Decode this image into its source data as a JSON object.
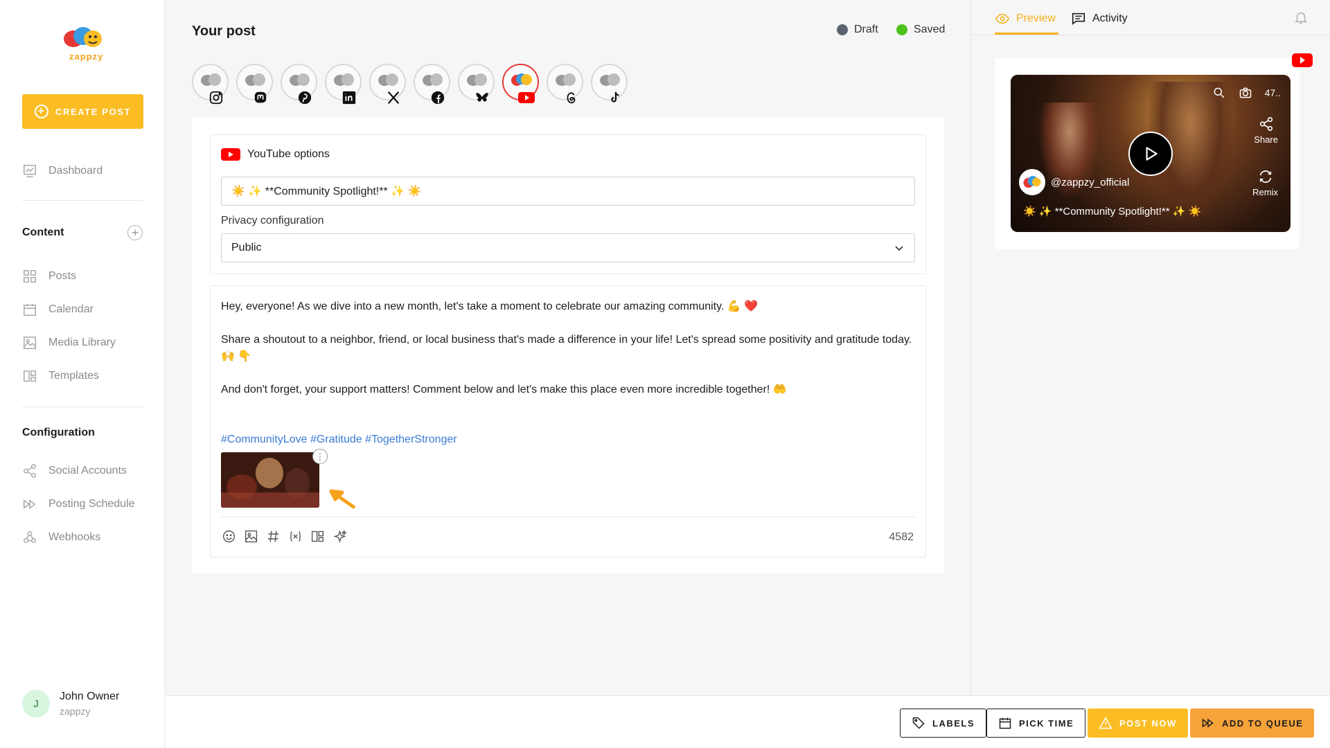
{
  "brand": {
    "logo_text": "zappzy",
    "accent": "#fbbd23",
    "youtube_red": "#ff0000"
  },
  "sidebar": {
    "create_label": "CREATE POST",
    "dashboard_label": "Dashboard",
    "content_title": "Content",
    "content_items": [
      {
        "label": "Posts",
        "icon": "grid-icon"
      },
      {
        "label": "Calendar",
        "icon": "calendar-icon"
      },
      {
        "label": "Media Library",
        "icon": "image-icon"
      },
      {
        "label": "Templates",
        "icon": "templates-icon"
      }
    ],
    "config_title": "Configuration",
    "config_items": [
      {
        "label": "Social Accounts",
        "icon": "share-icon"
      },
      {
        "label": "Posting Schedule",
        "icon": "schedule-icon"
      },
      {
        "label": "Webhooks",
        "icon": "webhook-icon"
      }
    ],
    "user": {
      "initial": "J",
      "name": "John Owner",
      "org": "zappzy"
    }
  },
  "main": {
    "title": "Your post",
    "status": {
      "draft": "Draft",
      "saved": "Saved",
      "draft_color": "#5b6270",
      "saved_color": "#4cc21b"
    },
    "accounts": [
      "instagram",
      "mastodon",
      "pinterest",
      "linkedin",
      "x",
      "facebook",
      "bluesky",
      "youtube",
      "threads",
      "tiktok"
    ],
    "active_account": "youtube",
    "youtube": {
      "header": "YouTube options",
      "title_value": "☀️ ✨ **Community Spotlight!** ✨ ☀️",
      "privacy_label": "Privacy configuration",
      "privacy_value": "Public"
    },
    "body": {
      "p1": "Hey, everyone! As we dive into a new month, let's take a moment to celebrate our amazing community. 💪 ❤️",
      "p2": "Share a shoutout to a neighbor, friend, or local business that's made a difference in your life! Let's spread some positivity and gratitude today. 🙌 👇",
      "p3": "And don't forget, your support matters! Comment below and let's make this place even more incredible together! 🤲",
      "hashtags": "#CommunityLove #Gratitude #TogetherStronger"
    },
    "char_count": "4582"
  },
  "right": {
    "tab_preview": "Preview",
    "tab_activity": "Activity",
    "video": {
      "handle": "@zappzy_official",
      "caption": "☀️ ✨ **Community Spotlight!** ✨ ☀️",
      "count": "47..",
      "share": "Share",
      "remix": "Remix"
    }
  },
  "bottom": {
    "labels": "LABELS",
    "pick_time": "PICK TIME",
    "post_now": "POST NOW",
    "add_queue": "ADD TO QUEUE"
  }
}
